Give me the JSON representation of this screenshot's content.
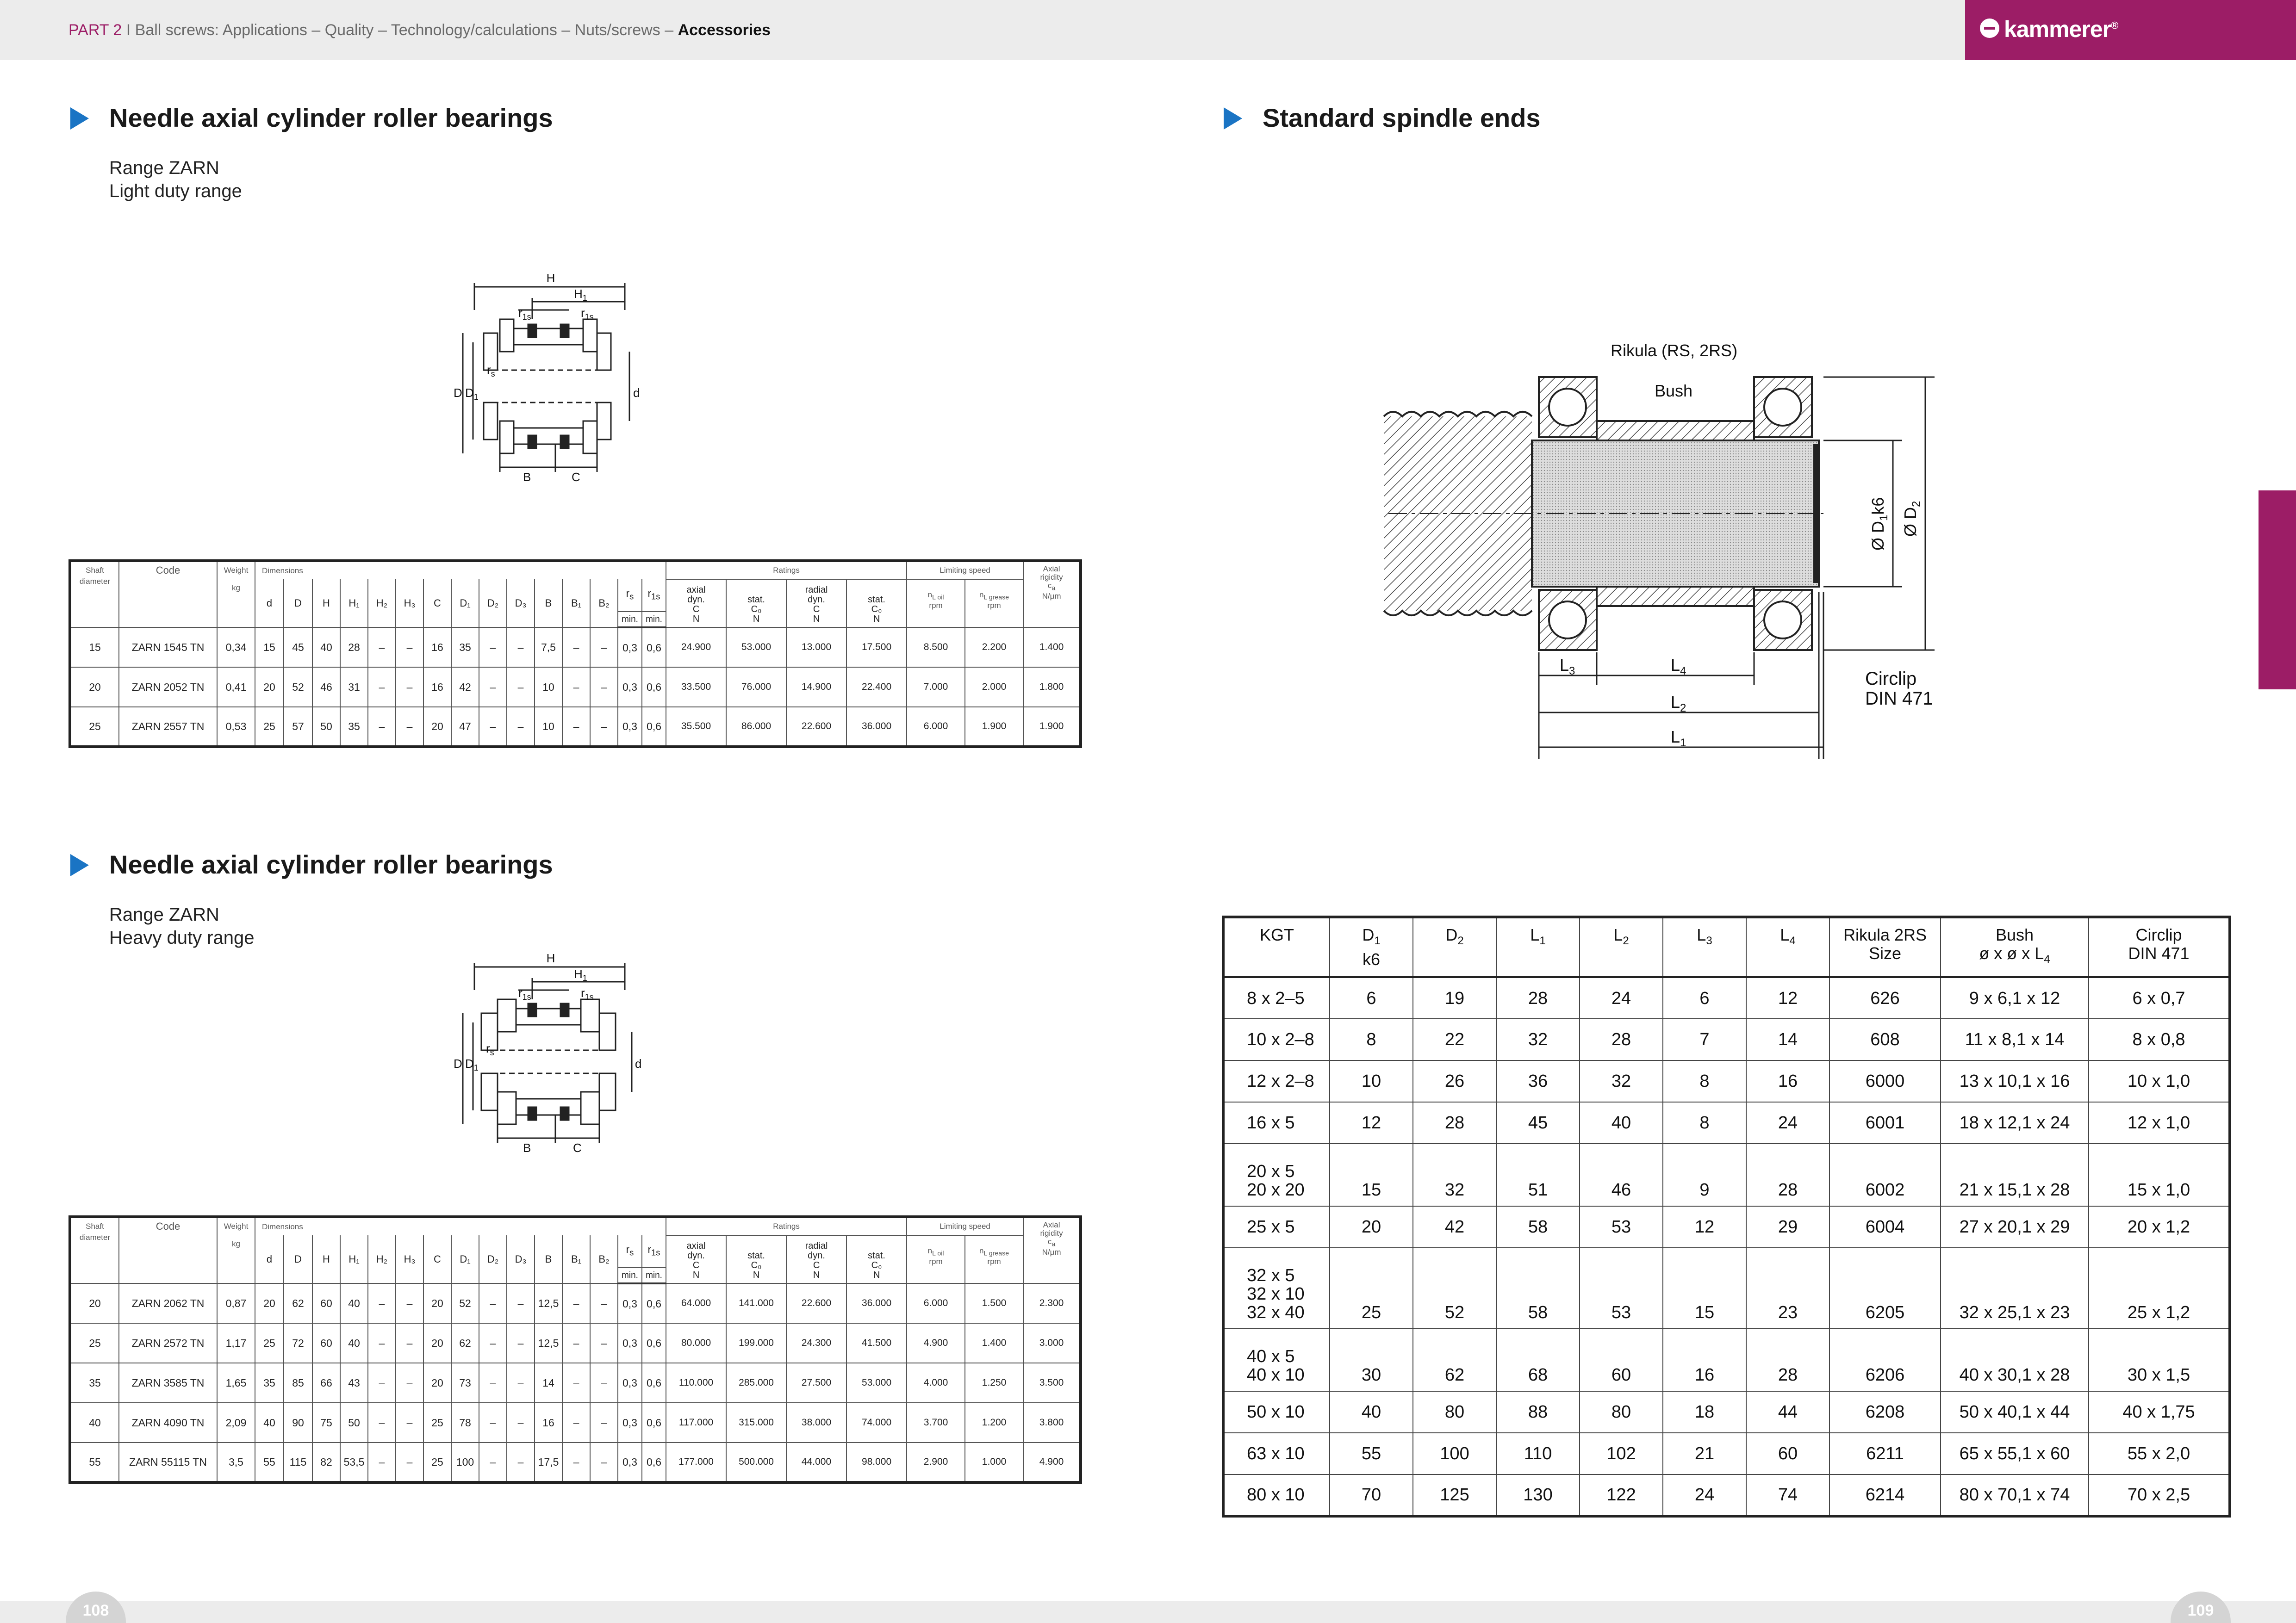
{
  "header": {
    "part": "PART 2",
    "sep": "I",
    "path": "Ball screws: Applications – Quality – Technology/calculations – Nuts/screws – ",
    "current": "Accessories"
  },
  "logo": {
    "text": "kammerer",
    "reg": "®"
  },
  "colors": {
    "brand": "#9c1d66",
    "bullet": "#1a74c4"
  },
  "left": {
    "title": "Needle axial cylinder roller bearings",
    "light": {
      "range": "Range ZARN",
      "duty": "Light duty range"
    },
    "heavy": {
      "range": "Range ZARN",
      "duty": "Heavy duty range"
    },
    "drawing": {
      "H": "H",
      "H1": "H",
      "H1s": "1",
      "r1s": "r",
      "r1s_sub": "1s",
      "rs": "r",
      "rs_sub": "s",
      "D": "D",
      "D1": "D",
      "D1_sub": "1",
      "d": "d",
      "B": "B",
      "C": "C"
    },
    "table_head": {
      "shaft": "Shaft",
      "diameter": "diameter",
      "code": "Code",
      "weight": "Weight",
      "kg": "kg",
      "dimensions": "Dimensions",
      "ratings": "Ratings",
      "limiting": "Limiting speed",
      "axial": "Axial",
      "rigidity": "rigidity",
      "ca": "c",
      "ca_sub": "a",
      "nmum": "N/µm",
      "cols": [
        "d",
        "D",
        "H",
        "H₁",
        "H₂",
        "H₃",
        "C",
        "D₁",
        "D₂",
        "D₃",
        "B",
        "B₁",
        "B₂",
        "r",
        "r"
      ],
      "rs_sub": "s",
      "r1s_sub": "1s",
      "min": "min.",
      "axial_dyn": [
        "axial",
        "dyn.",
        "C",
        "N"
      ],
      "stat1": [
        "stat.",
        "C₀",
        "N"
      ],
      "radial_dyn": [
        "radial",
        "dyn.",
        "C",
        "N"
      ],
      "stat2": [
        "stat.",
        "C₀",
        "N"
      ],
      "noil": "n",
      "noil_sub": "L oil",
      "grease": "n",
      "grease_sub": "L grease",
      "rpm": "rpm"
    },
    "light_rows": [
      [
        "15",
        "ZARN 1545 TN",
        "0,34",
        "15",
        "45",
        "40",
        "28",
        "–",
        "–",
        "16",
        "35",
        "–",
        "–",
        "7,5",
        "–",
        "–",
        "0,3",
        "0,6",
        "24.900",
        "53.000",
        "13.000",
        "17.500",
        "8.500",
        "2.200",
        "1.400"
      ],
      [
        "20",
        "ZARN 2052 TN",
        "0,41",
        "20",
        "52",
        "46",
        "31",
        "–",
        "–",
        "16",
        "42",
        "–",
        "–",
        "10",
        "–",
        "–",
        "0,3",
        "0,6",
        "33.500",
        "76.000",
        "14.900",
        "22.400",
        "7.000",
        "2.000",
        "1.800"
      ],
      [
        "25",
        "ZARN 2557 TN",
        "0,53",
        "25",
        "57",
        "50",
        "35",
        "–",
        "–",
        "20",
        "47",
        "–",
        "–",
        "10",
        "–",
        "–",
        "0,3",
        "0,6",
        "35.500",
        "86.000",
        "22.600",
        "36.000",
        "6.000",
        "1.900",
        "1.900"
      ]
    ],
    "heavy_rows": [
      [
        "20",
        "ZARN 2062 TN",
        "0,87",
        "20",
        "62",
        "60",
        "40",
        "–",
        "–",
        "20",
        "52",
        "–",
        "–",
        "12,5",
        "–",
        "–",
        "0,3",
        "0,6",
        "64.000",
        "141.000",
        "22.600",
        "36.000",
        "6.000",
        "1.500",
        "2.300"
      ],
      [
        "25",
        "ZARN 2572 TN",
        "1,17",
        "25",
        "72",
        "60",
        "40",
        "–",
        "–",
        "20",
        "62",
        "–",
        "–",
        "12,5",
        "–",
        "–",
        "0,3",
        "0,6",
        "80.000",
        "199.000",
        "24.300",
        "41.500",
        "4.900",
        "1.400",
        "3.000"
      ],
      [
        "35",
        "ZARN 3585 TN",
        "1,65",
        "35",
        "85",
        "66",
        "43",
        "–",
        "–",
        "20",
        "73",
        "–",
        "–",
        "14",
        "–",
        "–",
        "0,3",
        "0,6",
        "110.000",
        "285.000",
        "27.500",
        "53.000",
        "4.000",
        "1.250",
        "3.500"
      ],
      [
        "40",
        "ZARN 4090 TN",
        "2,09",
        "40",
        "90",
        "75",
        "50",
        "–",
        "–",
        "25",
        "78",
        "–",
        "–",
        "16",
        "–",
        "–",
        "0,3",
        "0,6",
        "117.000",
        "315.000",
        "38.000",
        "74.000",
        "3.700",
        "1.200",
        "3.800"
      ],
      [
        "55",
        "ZARN 55115 TN",
        "3,5",
        "55",
        "115",
        "82",
        "53,5",
        "–",
        "–",
        "25",
        "100",
        "–",
        "–",
        "17,5",
        "–",
        "–",
        "0,3",
        "0,6",
        "177.000",
        "500.000",
        "44.000",
        "98.000",
        "2.900",
        "1.000",
        "4.900"
      ]
    ]
  },
  "right": {
    "title": "Standard spindle ends",
    "drawing": {
      "rikula": "Rikula (RS, 2RS)",
      "bush": "Bush",
      "d1": "Ø D",
      "d1_sub": "1",
      "d1_k": "k6",
      "d2": "Ø D",
      "d2_sub": "2",
      "l3": "L",
      "l3_sub": "3",
      "l4": "L",
      "l4_sub": "4",
      "l2": "L",
      "l2_sub": "2",
      "l1": "L",
      "l1_sub": "1",
      "circlip1": "Circlip",
      "circlip2": "DIN 471"
    },
    "head": {
      "kgt": "KGT",
      "d1": "D",
      "d1_sub": "1",
      "k6": "k6",
      "d2": "D",
      "d2_sub": "2",
      "l1": "L",
      "l1_sub": "1",
      "l2": "L",
      "l2_sub": "2",
      "l3": "L",
      "l3_sub": "3",
      "l4": "L",
      "l4_sub": "4",
      "rikula1": "Rikula 2RS",
      "rikula2": "Size",
      "bush1": "Bush",
      "bush2": "ø x ø x L",
      "bush2_sub": "4",
      "circ1": "Circlip",
      "circ2": "DIN 471"
    },
    "rows": [
      {
        "kgt": [
          "8 x 2–5"
        ],
        "v": [
          "6",
          "19",
          "28",
          "24",
          "6",
          "12",
          "626",
          "9 x   6,1 x 12",
          "6 x 0,7"
        ]
      },
      {
        "kgt": [
          "10 x 2–8"
        ],
        "v": [
          "8",
          "22",
          "32",
          "28",
          "7",
          "14",
          "608",
          "11 x   8,1 x 14",
          "8 x 0,8"
        ]
      },
      {
        "kgt": [
          "12 x 2–8"
        ],
        "v": [
          "10",
          "26",
          "36",
          "32",
          "8",
          "16",
          "6000",
          "13 x 10,1 x 16",
          "10 x 1,0"
        ]
      },
      {
        "kgt": [
          "16 x   5"
        ],
        "v": [
          "12",
          "28",
          "45",
          "40",
          "8",
          "24",
          "6001",
          "18 x 12,1 x 24",
          "12 x 1,0"
        ]
      },
      {
        "kgt": [
          "20 x   5",
          "20 x 20"
        ],
        "v": [
          "15",
          "32",
          "51",
          "46",
          "9",
          "28",
          "6002",
          "21 x 15,1 x 28",
          "15 x 1,0"
        ]
      },
      {
        "kgt": [
          "25 x   5"
        ],
        "v": [
          "20",
          "42",
          "58",
          "53",
          "12",
          "29",
          "6004",
          "27 x 20,1 x 29",
          "20 x 1,2"
        ]
      },
      {
        "kgt": [
          "32 x   5",
          "32 x 10",
          "32 x 40"
        ],
        "v": [
          "25",
          "52",
          "58",
          "53",
          "15",
          "23",
          "6205",
          "32 x 25,1 x 23",
          "25 x 1,2"
        ]
      },
      {
        "kgt": [
          "40 x   5",
          "40 x 10"
        ],
        "v": [
          "30",
          "62",
          "68",
          "60",
          "16",
          "28",
          "6206",
          "40 x 30,1 x 28",
          "30 x 1,5"
        ]
      },
      {
        "kgt": [
          "50 x 10"
        ],
        "v": [
          "40",
          "80",
          "88",
          "80",
          "18",
          "44",
          "6208",
          "50 x 40,1 x 44",
          "40 x 1,75"
        ]
      },
      {
        "kgt": [
          "63 x 10"
        ],
        "v": [
          "55",
          "100",
          "110",
          "102",
          "21",
          "60",
          "6211",
          "65 x 55,1 x 60",
          "55 x 2,0"
        ]
      },
      {
        "kgt": [
          "80 x 10"
        ],
        "v": [
          "70",
          "125",
          "130",
          "122",
          "24",
          "74",
          "6214",
          "80 x 70,1 x 74",
          "70 x 2,5"
        ]
      }
    ]
  },
  "pages": {
    "left": "108",
    "right": "109"
  }
}
